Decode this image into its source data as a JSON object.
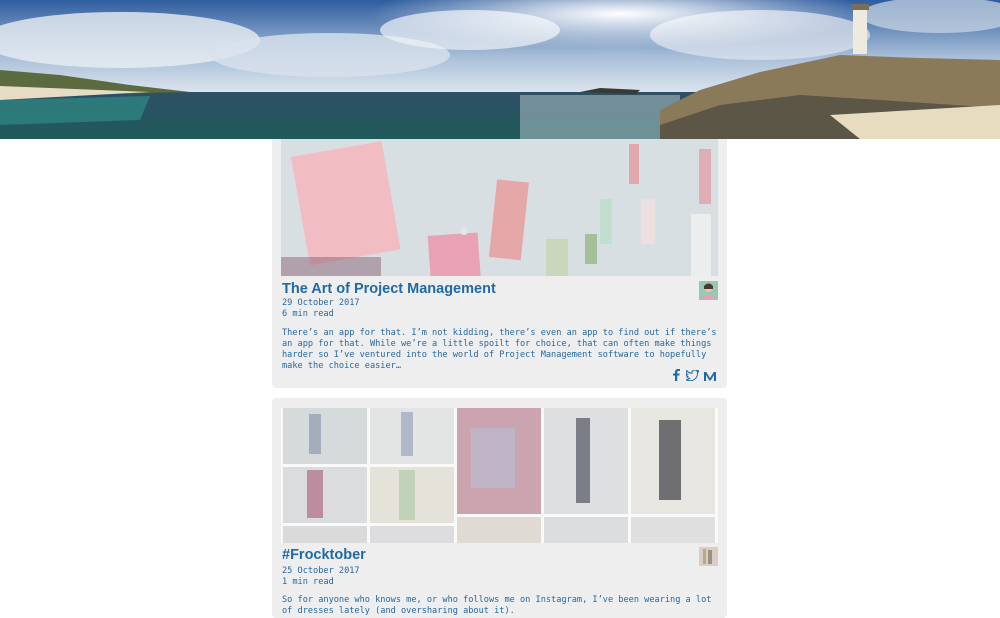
{
  "posts": [
    {
      "title": "The Art of Project Management",
      "date": "29 October 2017",
      "read_time": "6 min read",
      "excerpt": "There’s an app for that. I’m not kidding, there’s even an app to find out if there’s an app for that. While we’re a little spoilt for choice, that can often make things harder so I’ve ventured into the world of Project Management software to hopefully make the choice easier…",
      "share_icons": [
        "facebook-icon",
        "twitter-icon",
        "medium-icon"
      ]
    },
    {
      "title": "#Frocktober",
      "date": "25 October 2017",
      "read_time": "1 min read",
      "excerpt": "So for anyone who knows me, or who follows me on Instagram, I’ve been wearing a lot of dresses lately (and oversharing about it)."
    }
  ],
  "colors": {
    "link": "#1f6aa5",
    "card_bg": "#eeeeee"
  }
}
